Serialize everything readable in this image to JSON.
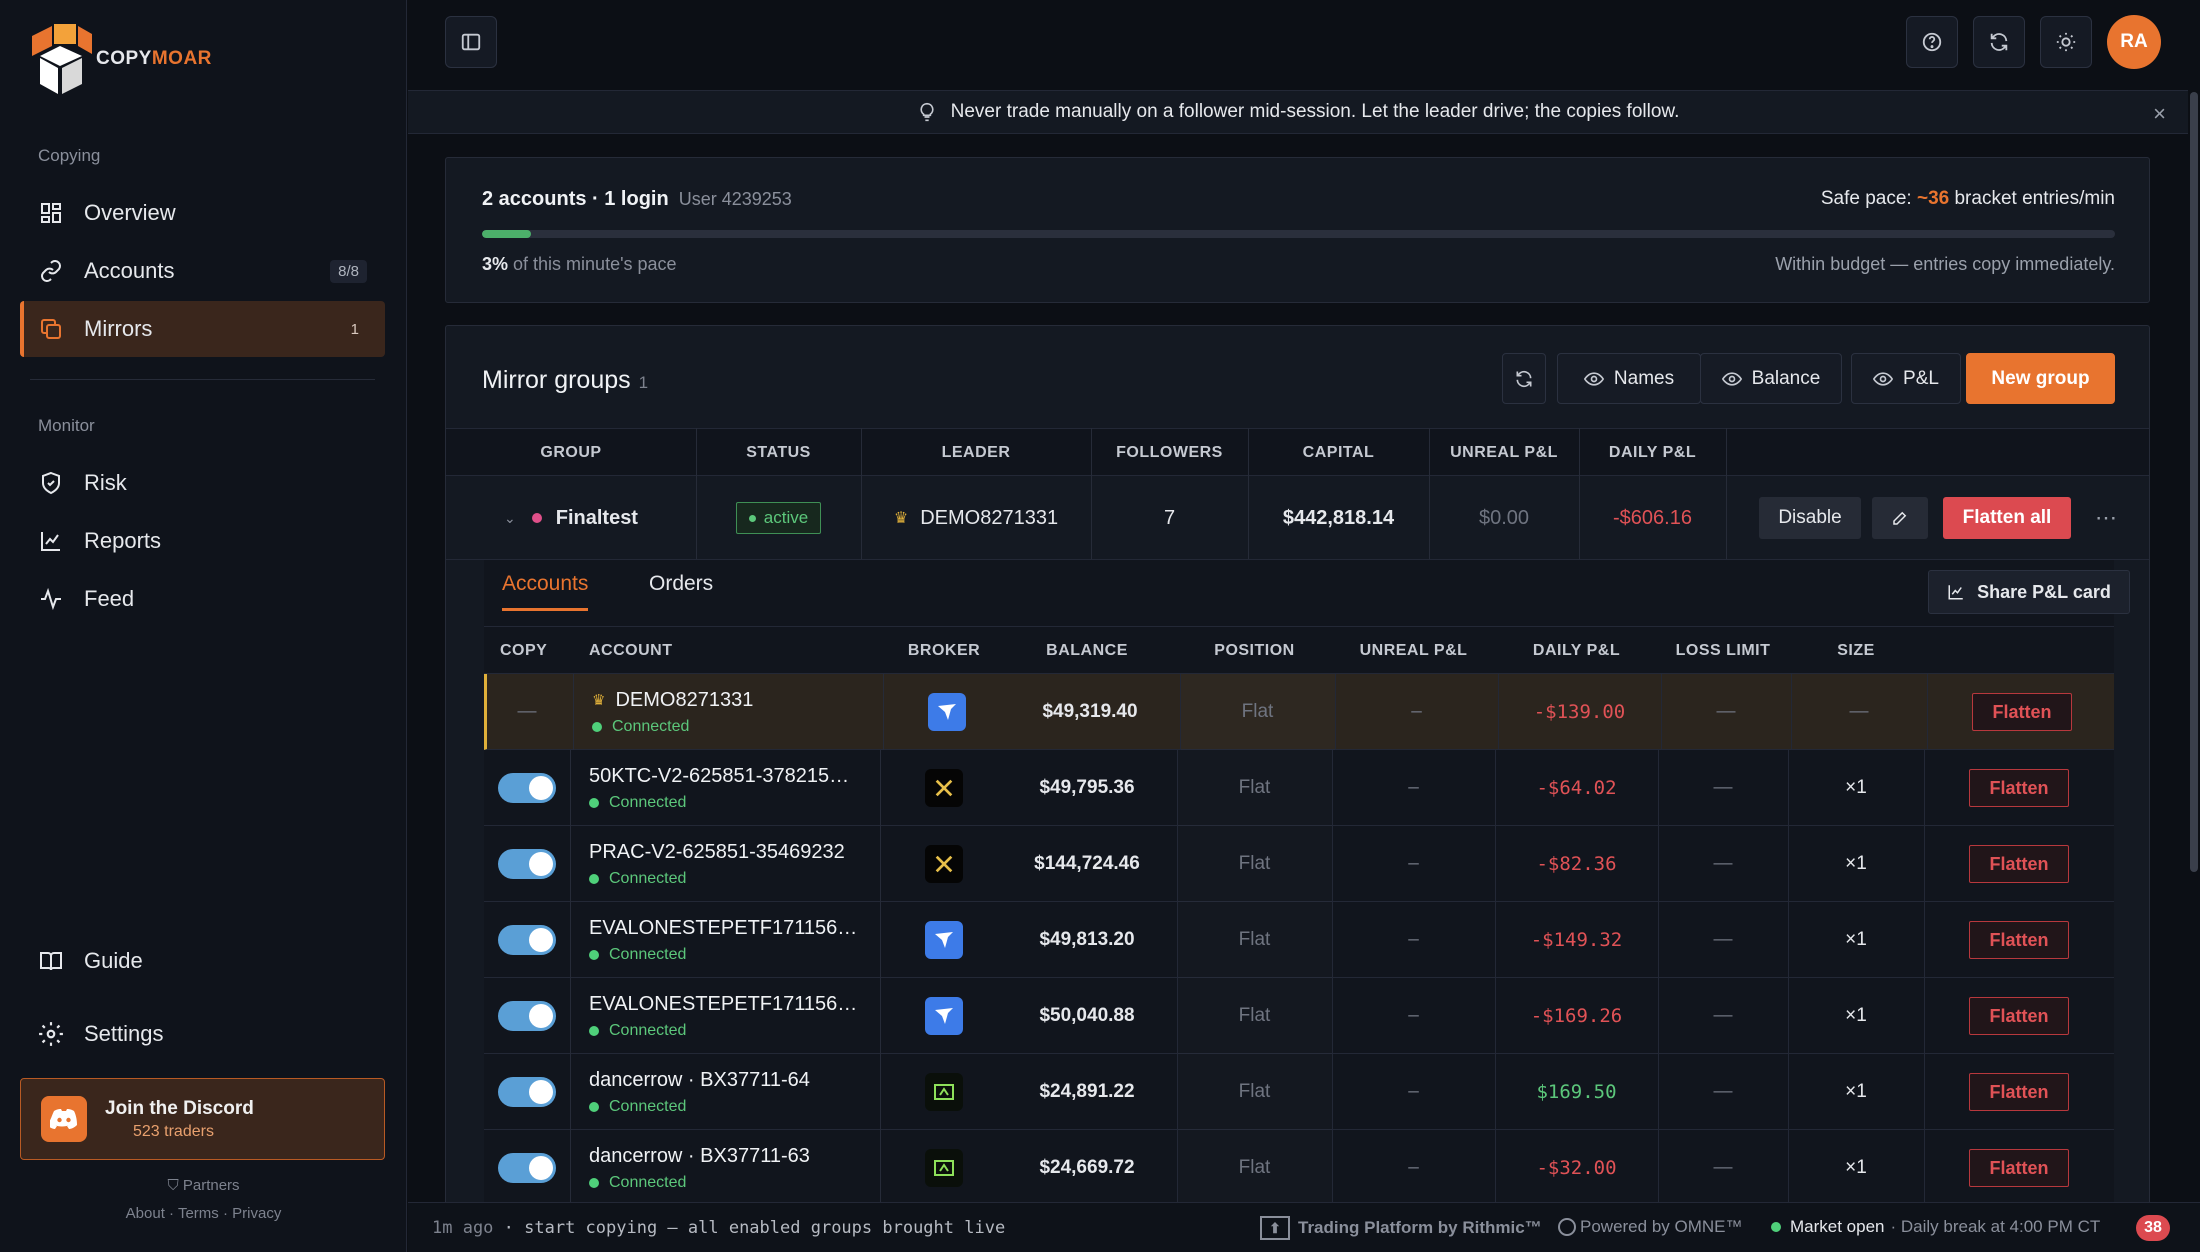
{
  "brand": {
    "name_a": "COPY",
    "name_b": "MOAR",
    "accent": "#e8742f"
  },
  "sidebar": {
    "section_copying": "Copying",
    "items": [
      {
        "label": "Overview",
        "icon": "grid-icon"
      },
      {
        "label": "Accounts",
        "icon": "link-icon",
        "badge": "8/8"
      },
      {
        "label": "Mirrors",
        "icon": "copy-icon",
        "badge": "1",
        "active": true
      }
    ],
    "section_monitor": "Monitor",
    "monitor_items": [
      {
        "label": "Risk",
        "icon": "shield-icon"
      },
      {
        "label": "Reports",
        "icon": "chart-icon"
      },
      {
        "label": "Feed",
        "icon": "activity-icon"
      }
    ],
    "guide": "Guide",
    "settings": "Settings",
    "discord": {
      "title": "Join the Discord",
      "sub": "523 traders"
    },
    "partners": "Partners",
    "about": "About",
    "terms": "Terms",
    "privacy": "Privacy",
    "dot": "·"
  },
  "header": {
    "avatar": "RA"
  },
  "tip": {
    "text": "Never trade manually on a follower mid-session. Let the leader drive; the copies follow.",
    "close": "×"
  },
  "pace": {
    "summary": "2 accounts · 1 login",
    "user": "User 4239253",
    "safe_label": "Safe pace:",
    "safe_value": "~36",
    "safe_unit": "bracket entries/min",
    "percent": "3%",
    "percent_label": "of this minute's pace",
    "progress": 0.03,
    "budget": "Within budget — entries copy immediately."
  },
  "groups": {
    "title": "Mirror groups",
    "count": "1",
    "btn_names": "Names",
    "btn_balance": "Balance",
    "btn_pnl": "P&L",
    "btn_new": "New group",
    "headers": [
      "GROUP",
      "STATUS",
      "LEADER",
      "FOLLOWERS",
      "CAPITAL",
      "UNREAL P&L",
      "DAILY P&L"
    ],
    "row": {
      "name": "Finaltest",
      "status": "active",
      "leader": "DEMO8271331",
      "followers": "7",
      "capital": "$442,818.14",
      "unreal": "$0.00",
      "daily": "-$606.16",
      "disable": "Disable",
      "flatten_all": "Flatten all"
    }
  },
  "detail": {
    "tab_accounts": "Accounts",
    "tab_orders": "Orders",
    "share": "Share P&L card",
    "headers": [
      "COPY",
      "ACCOUNT",
      "BROKER",
      "BALANCE",
      "POSITION",
      "UNREAL P&L",
      "DAILY P&L",
      "LOSS LIMIT",
      "SIZE"
    ],
    "dash": "—",
    "flatten": "Flatten",
    "rows": [
      {
        "account": "DEMO8271331",
        "status": "Connected",
        "broker": "blue",
        "balance": "$49,319.40",
        "position": "Flat",
        "unreal": "–",
        "daily": "-$139.00",
        "loss": "—",
        "size": "—",
        "leader": true
      },
      {
        "account": "50KTC-V2-625851-378215…",
        "status": "Connected",
        "broker": "black",
        "balance": "$49,795.36",
        "position": "Flat",
        "unreal": "–",
        "daily": "-$64.02",
        "loss": "—",
        "size": "×1"
      },
      {
        "account": "PRAC-V2-625851-35469232",
        "status": "Connected",
        "broker": "black",
        "balance": "$144,724.46",
        "position": "Flat",
        "unreal": "–",
        "daily": "-$82.36",
        "loss": "—",
        "size": "×1"
      },
      {
        "account": "EVALONESTEPETF1711560…",
        "status": "Connected",
        "broker": "blue",
        "balance": "$49,813.20",
        "position": "Flat",
        "unreal": "–",
        "daily": "-$149.32",
        "loss": "—",
        "size": "×1"
      },
      {
        "account": "EVALONESTEPETF1711560…",
        "status": "Connected",
        "broker": "blue",
        "balance": "$50,040.88",
        "position": "Flat",
        "unreal": "–",
        "daily": "-$169.26",
        "loss": "—",
        "size": "×1"
      },
      {
        "account": "dancerrow · BX37711-64",
        "status": "Connected",
        "broker": "green",
        "balance": "$24,891.22",
        "position": "Flat",
        "unreal": "–",
        "daily": "$169.50",
        "loss": "—",
        "size": "×1"
      },
      {
        "account": "dancerrow · BX37711-63",
        "status": "Connected",
        "broker": "green",
        "balance": "$24,669.72",
        "position": "Flat",
        "unreal": "–",
        "daily": "-$32.00",
        "loss": "—",
        "size": "×1"
      }
    ]
  },
  "statusbar": {
    "ago": "1m ago",
    "message": "· start copying — all enabled groups brought live",
    "rithmic": "Trading Platform by Rithmic™",
    "omne": "Powered by OMNE™",
    "market": "Market open",
    "break": "· Daily break at 4:00 PM CT",
    "count": "38"
  }
}
